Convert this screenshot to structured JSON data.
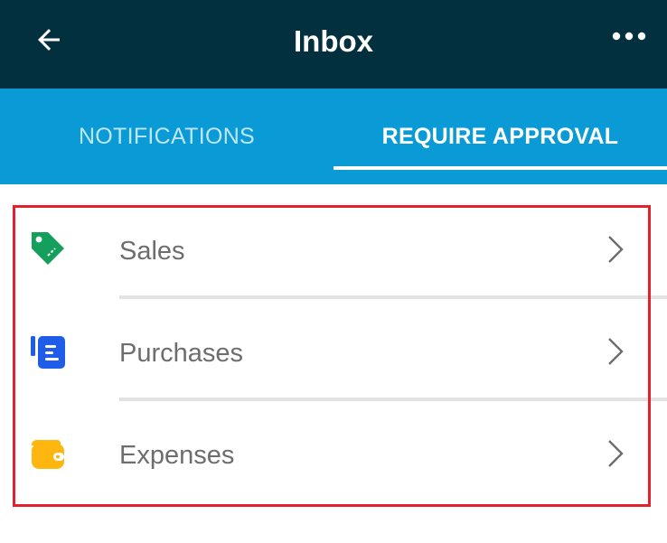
{
  "header": {
    "title": "Inbox",
    "back_icon": "arrow-left-icon",
    "more_icon": "more-horizontal-icon"
  },
  "tabs": [
    {
      "label": "NOTIFICATIONS",
      "selected": false
    },
    {
      "label": "REQUIRE APPROVAL",
      "selected": true
    }
  ],
  "approval_list": {
    "items": [
      {
        "label": "Sales",
        "icon": "price-tag-icon",
        "icon_color": "#14a05c"
      },
      {
        "label": "Purchases",
        "icon": "purchase-list-icon",
        "icon_color": "#1f5de8"
      },
      {
        "label": "Expenses",
        "icon": "wallet-icon",
        "icon_color": "#ffb70f"
      }
    ]
  },
  "colors": {
    "appbar": "#03303f",
    "tabbar": "#0a9ad6",
    "highlight": "#e4202c"
  }
}
